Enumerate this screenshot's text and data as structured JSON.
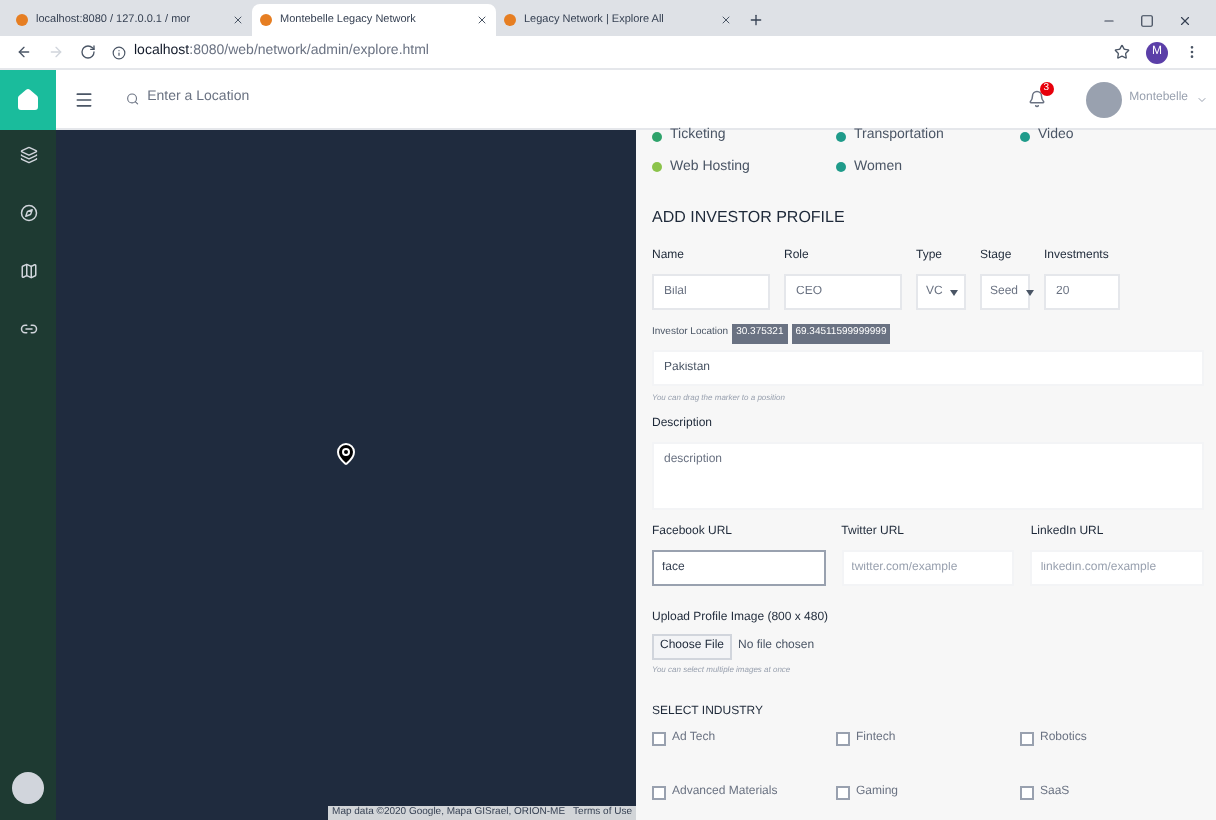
{
  "browser": {
    "tabs": [
      {
        "title": "localhost:8080 / 127.0.0.1 / mor",
        "selected": false
      },
      {
        "title": "Montebelle Legacy Network",
        "selected": true
      },
      {
        "title": "Legacy Network | Explore All",
        "selected": false
      }
    ],
    "url_host": "localhost",
    "url_path": ":8080/web/network/admin/explore.html",
    "profile_initial": "M"
  },
  "header": {
    "search_placeholder": "Enter a Location",
    "notification_count": "3",
    "user_name": "Montebelle"
  },
  "sidebar": {
    "items": [
      {
        "kind": "layers",
        "selected": false
      },
      {
        "kind": "compass",
        "selected": false
      },
      {
        "kind": "map",
        "selected": false
      },
      {
        "kind": "link",
        "selected": false
      }
    ]
  },
  "map": {
    "attribution": "Map data ©2020 Google, Mapa GISrael, ORION-ME",
    "terms": "Terms of Use"
  },
  "tags_row_1": [
    {
      "label": "Ticketing",
      "color": "#2fa36b"
    },
    {
      "label": "Transportation",
      "color": "#1f9b8a"
    },
    {
      "label": "Video",
      "color": "#1f9b8a"
    }
  ],
  "tags_row_2": [
    {
      "label": "Web Hosting",
      "color": "#8bc34a"
    },
    {
      "label": "Women",
      "color": "#1f9b8a"
    }
  ],
  "form": {
    "title": "ADD INVESTOR PROFILE",
    "fields": [
      {
        "label": "Name",
        "kind": "text",
        "value": "Bilal"
      },
      {
        "label": "Role",
        "kind": "text",
        "value": "CEO"
      },
      {
        "label": "Type",
        "kind": "select",
        "value": "VC"
      },
      {
        "label": "Stage",
        "kind": "select",
        "value": "Seed"
      },
      {
        "label": "Investments",
        "kind": "text",
        "value": "20"
      }
    ],
    "location_label": "Investor Location",
    "lat": "30.375321",
    "lng": "69.34511599999999",
    "location_value": "Pakistan",
    "location_hint": "You can drag the marker to a position",
    "description_label": "Description",
    "description_value": "description",
    "urls": [
      {
        "label": "Facebook URL",
        "value": "face",
        "focused": true
      },
      {
        "label": "Twitter URL",
        "placeholder": "twitter.com/example",
        "focused": false
      },
      {
        "label": "LinkedIn URL",
        "placeholder": "linkedin.com/example",
        "focused": false
      }
    ],
    "upload_label": "Upload Profile Image (800 x 480)",
    "choose_file": "Choose File",
    "no_file": "No file chosen",
    "upload_hint": "You can select multiple images at once",
    "industry_title": "SELECT INDUSTRY",
    "industries": [
      {
        "label": "Ad Tech",
        "checked": false
      },
      {
        "label": "Fintech",
        "checked": false
      },
      {
        "label": "Robotics",
        "checked": false
      },
      {
        "label": "Advanced Materials",
        "checked": false
      },
      {
        "label": "Gaming",
        "checked": false
      },
      {
        "label": "SaaS",
        "checked": false
      }
    ]
  }
}
